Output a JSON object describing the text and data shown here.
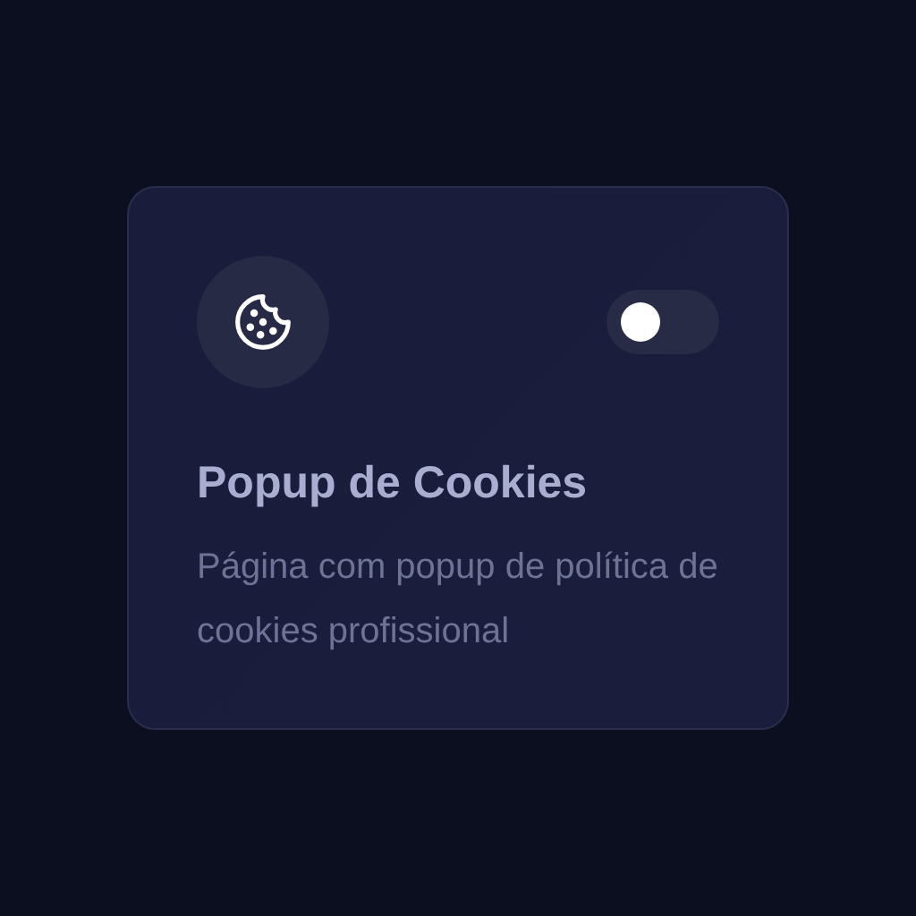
{
  "card": {
    "title": "Popup de Cookies",
    "description": "Página com popup de política de cookies profissional",
    "toggle": {
      "on": false
    }
  }
}
